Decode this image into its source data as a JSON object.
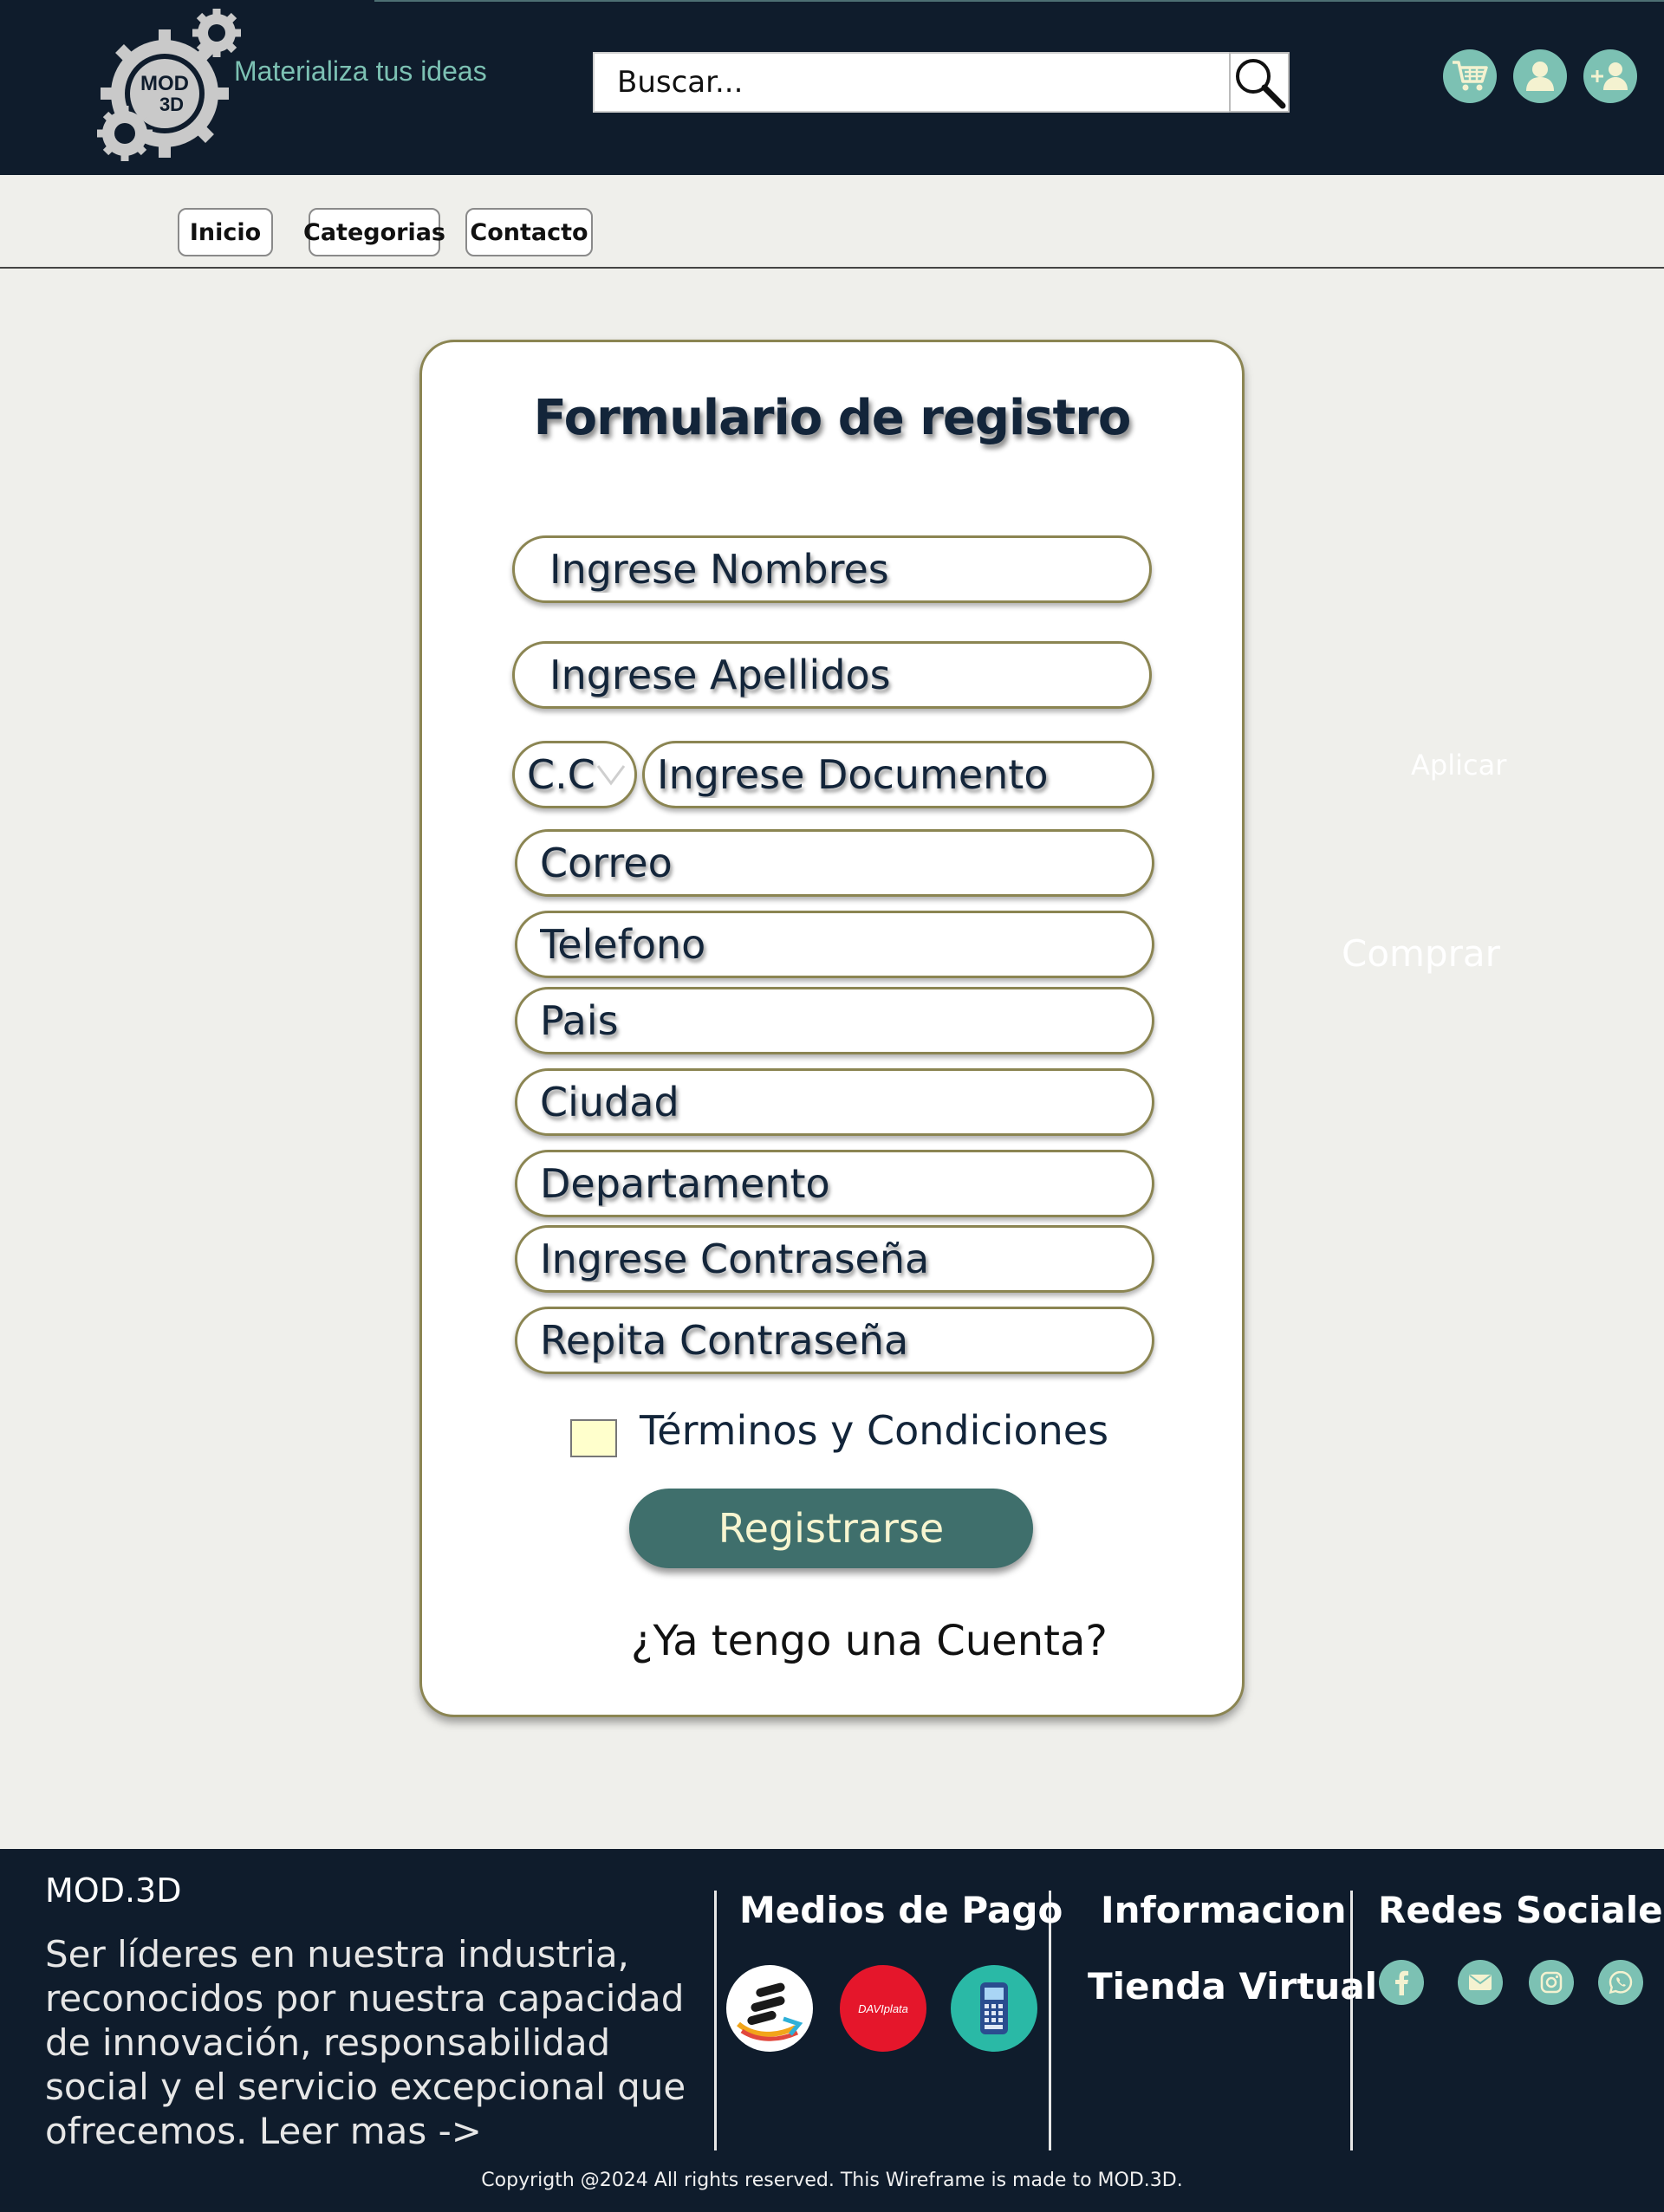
{
  "header": {
    "tagline": "Materializa tus ideas",
    "logo_text_line1": "MOD",
    "logo_text_line2": "3D",
    "search_placeholder": "Buscar...",
    "icons": [
      "cart-icon",
      "user-icon",
      "add-user-icon"
    ]
  },
  "nav": {
    "items": [
      {
        "label": "Inicio"
      },
      {
        "label": "Categorias"
      },
      {
        "label": "Contacto"
      }
    ]
  },
  "form": {
    "title": "Formulario de registro",
    "fields": {
      "nombres": "Ingrese Nombres",
      "apellidos": "Ingrese Apellidos",
      "doc_type": "C.C",
      "documento": "Ingrese Documento",
      "correo": "Correo",
      "telefono": "Telefono",
      "pais": "Pais",
      "ciudad": "Ciudad",
      "departamento": "Departamento",
      "password": "Ingrese Contraseña",
      "password_repeat": "Repita Contraseña"
    },
    "terms_label": "Términos y Condiciones",
    "terms_checked": false,
    "register_label": "Registrarse",
    "account_link": "¿Ya tengo una Cuenta?"
  },
  "ghost": {
    "apply": "Aplicar",
    "buy": "Comprar"
  },
  "footer": {
    "brand": "MOD.3D",
    "mission": "Ser líderes en nuestra industria, reconocidos por nuestra capacidad de innovación, responsabilidad social y el servicio excepcional que ofrecemos.  Leer mas ->",
    "payments_heading": "Medios de Pago",
    "daviplata_label": "DAVIplata",
    "info_heading": "Informacion",
    "info_link": "Tienda Virtual",
    "social_heading": "Redes Sociales",
    "social_icons": [
      "facebook-icon",
      "email-icon",
      "instagram-icon",
      "whatsapp-icon"
    ],
    "copyright": "Copyrigth @2024 All rights reserved. This Wireframe is made to MOD.3D."
  },
  "colors": {
    "header_bg": "#0f1c2c",
    "accent_teal": "#7cc1b3",
    "button_teal": "#3f6f6c",
    "field_border": "#8b8552",
    "page_bg": "#efefeb"
  }
}
